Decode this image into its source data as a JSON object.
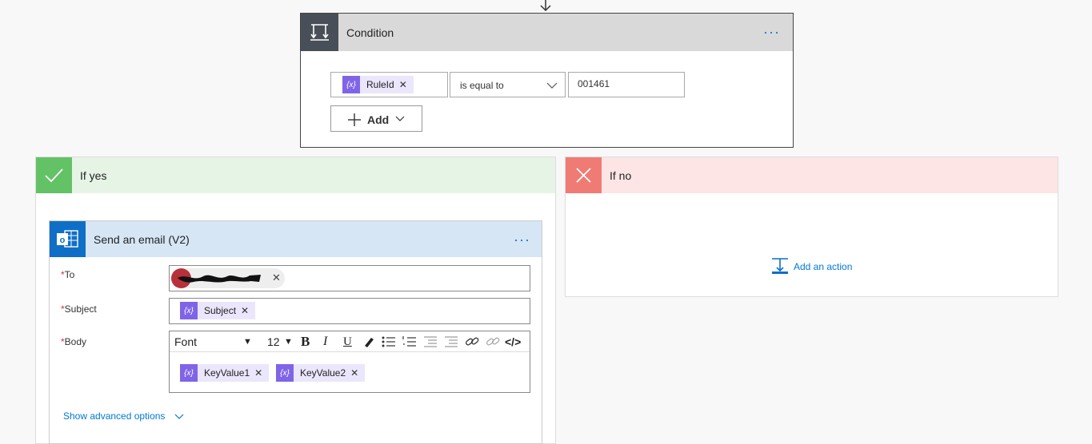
{
  "condition": {
    "title": "Condition",
    "menu": "···",
    "left_token": "RuleId",
    "token_icon": "{x}",
    "operator": "is equal to",
    "right_value": "001461",
    "add_label": "Add"
  },
  "yes_branch": {
    "title": "If yes",
    "email": {
      "title": "Send an email (V2)",
      "menu": "···",
      "to_label": "To",
      "subject_label": "Subject",
      "body_label": "Body",
      "subject_token": "Subject",
      "body_tokens": [
        "KeyValue1",
        "KeyValue2"
      ],
      "toolbar": {
        "font": "Font",
        "size": "12",
        "bold": "B",
        "italic": "I",
        "underline": "U",
        "code": "</>"
      },
      "advanced_link": "Show advanced options"
    }
  },
  "no_branch": {
    "title": "If no",
    "add_action": "Add an action"
  },
  "colors": {
    "accent": "#0078d4",
    "token_icon": "#8064e8",
    "yes": "#63c266",
    "no": "#f07b74",
    "outlook": "#0f6fc6"
  }
}
